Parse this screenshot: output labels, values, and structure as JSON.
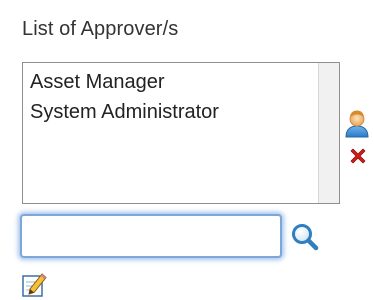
{
  "approvers": {
    "label": "List of Approver/s",
    "items": [
      "Asset Manager",
      "System Administrator"
    ],
    "search": {
      "value": "",
      "placeholder": ""
    },
    "icons": {
      "add": "user-icon",
      "remove": "red-x-icon",
      "search": "magnifier-icon",
      "edit": "pencil-notepad-icon"
    }
  },
  "colors": {
    "focus_ring": "#7ea6d9",
    "remove_red": "#d21c1c",
    "search_blue": "#2f7ec0"
  }
}
